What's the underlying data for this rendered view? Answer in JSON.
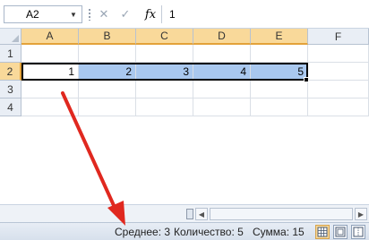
{
  "formula_bar": {
    "name_box": "A2",
    "cancel_glyph": "✕",
    "enter_glyph": "✓",
    "fx_label": "fx",
    "formula_value": "1"
  },
  "grid": {
    "columns": [
      "A",
      "B",
      "C",
      "D",
      "E",
      "F"
    ],
    "rows": [
      "1",
      "2",
      "3",
      "4"
    ],
    "selected_column_headers": [
      "A",
      "B",
      "C",
      "D",
      "E"
    ],
    "selected_row": "2",
    "active_cell": "A2",
    "row2_values": [
      "1",
      "2",
      "3",
      "4",
      "5"
    ]
  },
  "status_bar": {
    "average": "Среднее: 3",
    "count": "Количество: 5",
    "sum": "Сумма: 15"
  },
  "icons": {
    "name_box_dropdown": "chevron-down-icon",
    "view_normal": "normal-view-icon",
    "view_page_layout": "page-layout-view-icon",
    "view_page_break": "page-break-view-icon"
  },
  "colors": {
    "selection_fill": "#a9c8ef",
    "header_highlight": "#f9d99a",
    "arrow": "#e0281f"
  }
}
